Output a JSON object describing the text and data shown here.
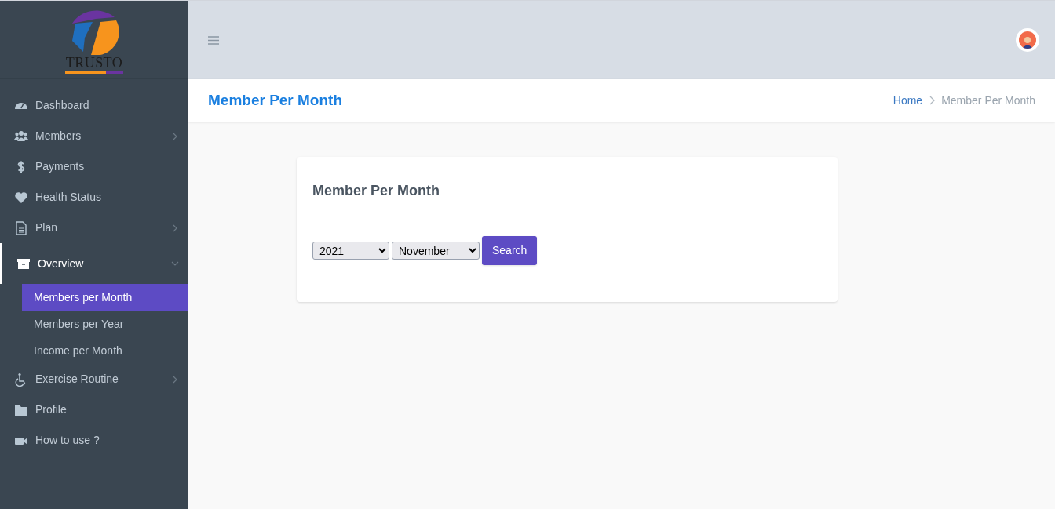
{
  "logo": {
    "text": "TRUSTO"
  },
  "sidebar": {
    "items": [
      {
        "kind": "link",
        "label": "Dashboard",
        "selected": false
      },
      {
        "kind": "group",
        "label": "Members",
        "expanded": false,
        "selected": false
      },
      {
        "kind": "link",
        "label": "Payments",
        "selected": false
      },
      {
        "kind": "link",
        "label": "Health Status",
        "selected": false
      },
      {
        "kind": "group",
        "label": "Plan",
        "expanded": false,
        "selected": false
      },
      {
        "kind": "group",
        "label": "Overview",
        "expanded": true,
        "selected": true,
        "children": [
          {
            "label": "Members per Month",
            "selected": true
          },
          {
            "label": "Members per Year",
            "selected": false
          },
          {
            "label": "Income per Month",
            "selected": false
          }
        ]
      },
      {
        "kind": "group",
        "label": "Exercise Routine",
        "expanded": false,
        "selected": false
      },
      {
        "kind": "link",
        "label": "Profile",
        "selected": false
      },
      {
        "kind": "link",
        "label": "How to use ?",
        "selected": false
      }
    ]
  },
  "page_header": {
    "title": "Member Per Month",
    "breadcrumb": [
      "Home",
      "Member Per Month"
    ]
  },
  "card": {
    "title": "Member Per Month",
    "year_select": {
      "value": "2021"
    },
    "month_select": {
      "value": "November"
    },
    "search_button": "Search"
  }
}
